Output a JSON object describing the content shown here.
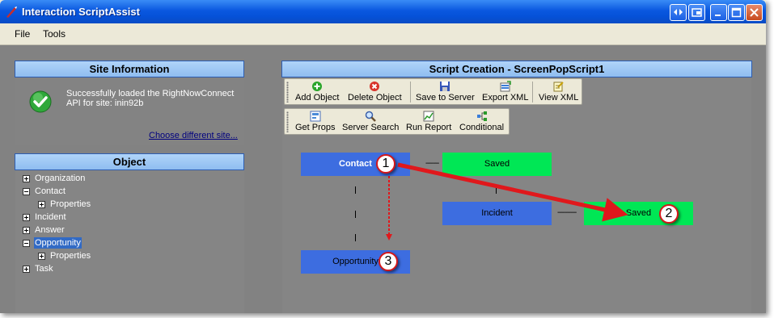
{
  "window": {
    "title": "Interaction ScriptAssist"
  },
  "menu": {
    "file": "File",
    "tools": "Tools"
  },
  "site_panel": {
    "title": "Site Information",
    "message_line1": "Successfully loaded the RightNowConnect",
    "message_line2": "API for site: inin92b",
    "link": "Choose different site..."
  },
  "object_panel": {
    "title": "Object",
    "items": [
      {
        "label": "Organization",
        "expanded": false
      },
      {
        "label": "Contact",
        "expanded": true
      },
      {
        "label": "Properties",
        "expanded": false
      },
      {
        "label": "Incident",
        "expanded": false
      },
      {
        "label": "Answer",
        "expanded": false
      },
      {
        "label": "Opportunity",
        "expanded": true,
        "selected": true
      },
      {
        "label": "Properties",
        "expanded": false
      },
      {
        "label": "Task",
        "expanded": false
      }
    ]
  },
  "script_panel": {
    "title": "Script Creation - ScreenPopScript1",
    "toolbar1": {
      "add_object": "Add Object",
      "delete_object": "Delete Object",
      "save_to_server": "Save to Server",
      "export_xml": "Export XML",
      "view_xml": "View XML"
    },
    "toolbar2": {
      "get_props": "Get Props",
      "server_search": "Server Search",
      "run_report": "Run Report",
      "conditional": "Conditional"
    },
    "nodes": {
      "contact": "Contact",
      "saved1": "Saved",
      "incident": "Incident",
      "saved2": "Saved",
      "opportunity": "Opportunity"
    },
    "connectors": {
      "dash_short": "-------",
      "dash_long": "----------",
      "pipe": "|"
    },
    "callouts": [
      "1",
      "2",
      "3"
    ]
  },
  "colors": {
    "node_blue": "#3d6de0",
    "node_green": "#00e755",
    "arrow_red": "#e0181c"
  }
}
